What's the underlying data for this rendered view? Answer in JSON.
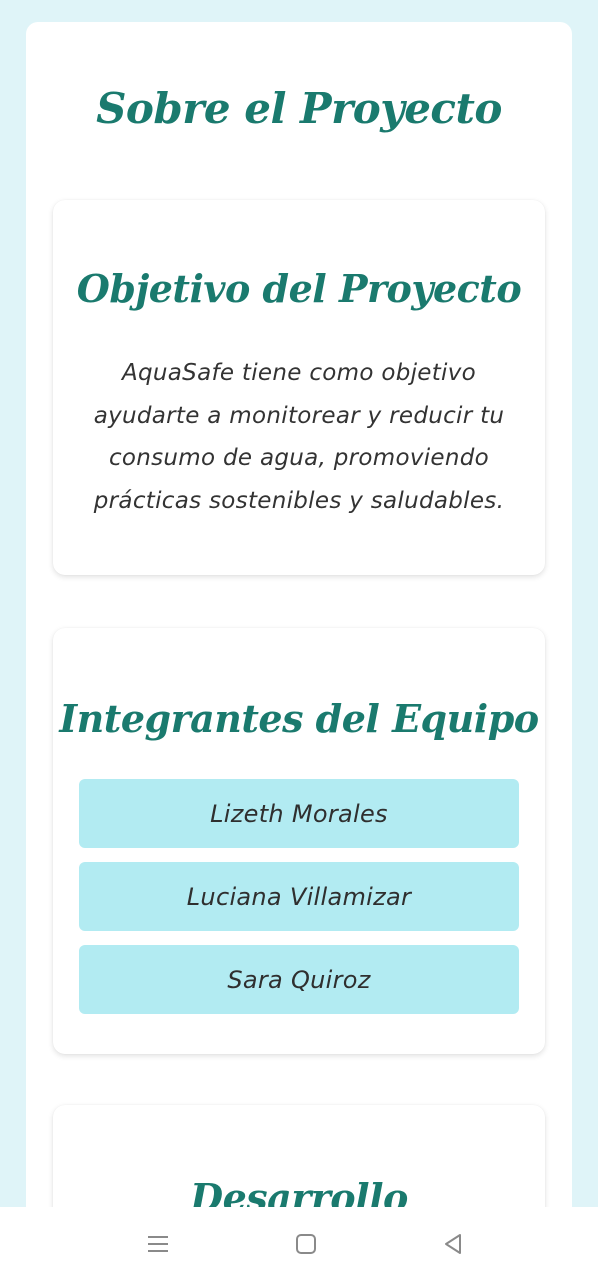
{
  "page": {
    "title": "Sobre el Proyecto"
  },
  "objective": {
    "title": "Objetivo del Proyecto",
    "text": "AquaSafe tiene como objetivo ayudarte a monitorear y reducir tu consumo de agua, promoviendo prácticas sostenibles y saludables."
  },
  "team": {
    "title": "Integrantes del Equipo",
    "members": [
      "Lizeth Morales",
      "Luciana Villamizar",
      "Sara Quiroz"
    ]
  },
  "development": {
    "title": "Desarrollo"
  },
  "nav": {
    "icons": [
      "menu-icon",
      "home-icon",
      "back-icon"
    ]
  },
  "colors": {
    "background": "#dff4f8",
    "title": "#1a7a6e",
    "member_bg": "#b2ebf2"
  }
}
